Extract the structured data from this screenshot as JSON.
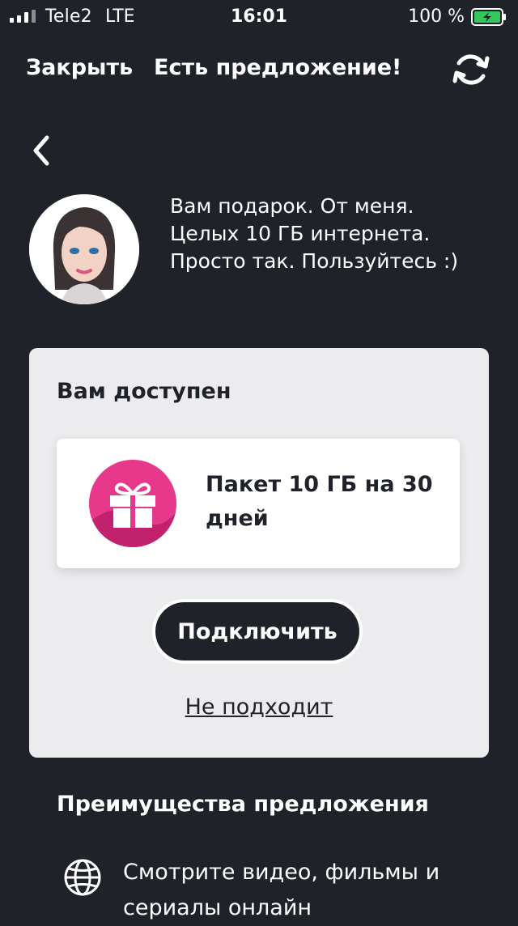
{
  "status_bar": {
    "carrier": "Tele2",
    "network": "LTE",
    "time": "16:01",
    "battery_percent": "100 %",
    "battery_color": "#34c759"
  },
  "nav": {
    "close_label": "Закрыть",
    "title": "Есть предложение!",
    "refresh_icon": "refresh-icon"
  },
  "back_icon": "chevron-left-icon",
  "assistant": {
    "message_lines": [
      "Вам подарок. От меня.",
      "Целых 10 ГБ интернета.",
      "Просто так. Пользуйтесь :)"
    ]
  },
  "offer": {
    "title": "Вам доступен",
    "package_name": "Пакет 10 ГБ на 30 дней",
    "gift_icon": "gift-icon",
    "accent_color": "#e7398b",
    "connect_label": "Подключить",
    "decline_label": "Не подходит"
  },
  "benefits": {
    "title": "Преимущества предложения",
    "items": [
      {
        "icon": "globe-icon",
        "text": "Смотрите видео, фильмы и сериалы онлайн"
      }
    ]
  }
}
